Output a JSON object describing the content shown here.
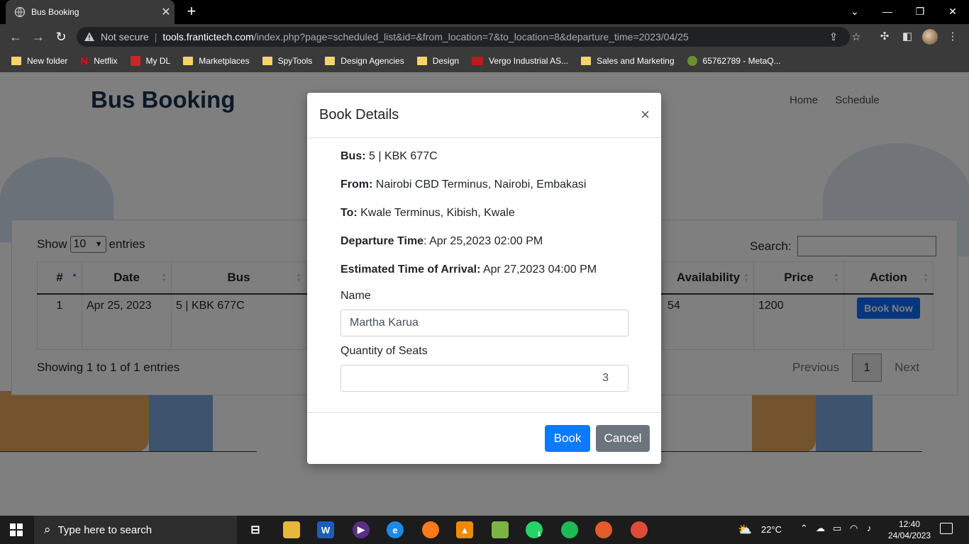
{
  "browser": {
    "tab_title": "Bus Booking",
    "security_label": "Not secure",
    "url_host": "tools.frantictech.com",
    "url_path": "/index.php?page=scheduled_list&id=&from_location=7&to_location=8&departure_time=2023/04/25",
    "bookmarks": [
      {
        "label": "New folder",
        "icon": "folder-icon"
      },
      {
        "label": "Netflix",
        "icon": "netflix-icon"
      },
      {
        "label": "My DL",
        "icon": "mydl-icon"
      },
      {
        "label": "Marketplaces",
        "icon": "folder-icon"
      },
      {
        "label": "SpyTools",
        "icon": "folder-icon"
      },
      {
        "label": "Design Agencies",
        "icon": "folder-icon"
      },
      {
        "label": "Design",
        "icon": "folder-icon"
      },
      {
        "label": "Vergo Industrial AS...",
        "icon": "vergo-icon"
      },
      {
        "label": "Sales and Marketing",
        "icon": "folder-icon"
      },
      {
        "label": "65762789 - MetaQ...",
        "icon": "metaq-icon"
      }
    ]
  },
  "site": {
    "brand": "Bus Booking",
    "nav": [
      "Home",
      "Schedule"
    ]
  },
  "table": {
    "show_label": "Show",
    "length_value": "10",
    "entries_label": "entries",
    "search_label": "Search:",
    "columns": [
      "#",
      "Date",
      "Bus",
      "",
      "",
      "Availability",
      "Price",
      "Action"
    ],
    "row": {
      "num": "1",
      "date": "Apr 25, 2023",
      "bus": "5 | KBK 677C",
      "availability": "54",
      "price": "1200",
      "action": "Book Now"
    },
    "info": "Showing 1 to 1 of 1 entries",
    "prev": "Previous",
    "page": "1",
    "next": "Next"
  },
  "modal": {
    "title": "Book Details",
    "close": "×",
    "bus_label": "Bus:",
    "bus_value": " 5 | KBK 677C",
    "from_label": "From:",
    "from_value": " Nairobi CBD Terminus, Nairobi, Embakasi",
    "to_label": "To:",
    "to_value": " Kwale Terminus, Kibish, Kwale",
    "departure_label": "Departure Time",
    "departure_value": ": Apr 25,2023 02:00 PM",
    "eta_label": "Estimated Time of Arrival:",
    "eta_value": " Apr 27,2023 04:00 PM",
    "name_label": "Name",
    "name_value": "Martha Karua",
    "qty_label": "Quantity of Seats",
    "qty_value": "3",
    "book_button": "Book",
    "cancel_button": "Cancel"
  },
  "taskbar": {
    "search_placeholder": "Type here to search",
    "temperature": "22°C",
    "time": "12:40",
    "date": "24/04/2023",
    "whatsapp_badge": "1"
  }
}
